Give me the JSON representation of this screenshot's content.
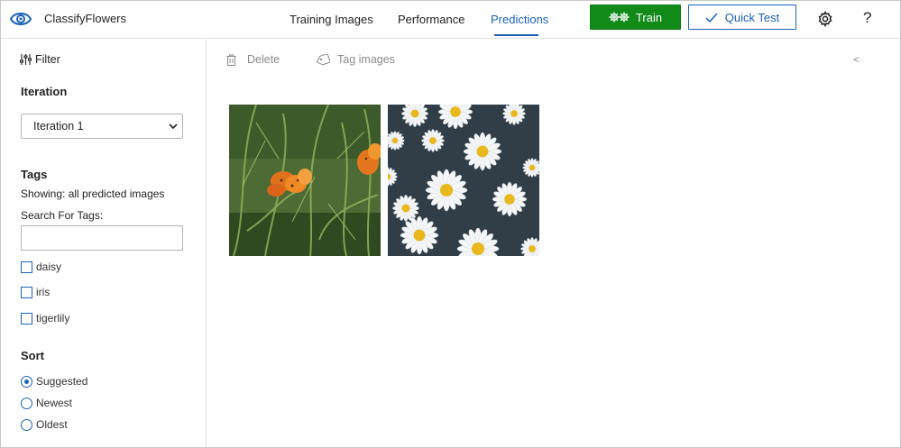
{
  "app": {
    "title": "ClassifyFlowers"
  },
  "tabs": [
    {
      "label": "Training Images",
      "active": false
    },
    {
      "label": "Performance",
      "active": false
    },
    {
      "label": "Predictions",
      "active": true
    }
  ],
  "actions": {
    "train_label": "Train",
    "quick_test_label": "Quick Test",
    "help_label": "?"
  },
  "colors": {
    "accent": "#1a63b8",
    "train_bg": "#118a1a"
  },
  "sidebar": {
    "filter_label": "Filter",
    "iteration_heading": "Iteration",
    "iteration_selected": "Iteration 1",
    "tags_heading": "Tags",
    "showing_text": "Showing: all predicted images",
    "search_label": "Search For Tags:",
    "search_value": "",
    "tags": [
      {
        "label": "daisy",
        "checked": false
      },
      {
        "label": "iris",
        "checked": false
      },
      {
        "label": "tigerlily",
        "checked": false
      }
    ],
    "sort_heading": "Sort",
    "sort_options": [
      {
        "label": "Suggested",
        "checked": true
      },
      {
        "label": "Newest",
        "checked": false
      },
      {
        "label": "Oldest",
        "checked": false
      }
    ]
  },
  "toolbar": {
    "delete_label": "Delete",
    "tag_images_label": "Tag images",
    "prev_label": "<"
  },
  "images": [
    {
      "subject": "tigerlily"
    },
    {
      "subject": "daisy"
    }
  ]
}
